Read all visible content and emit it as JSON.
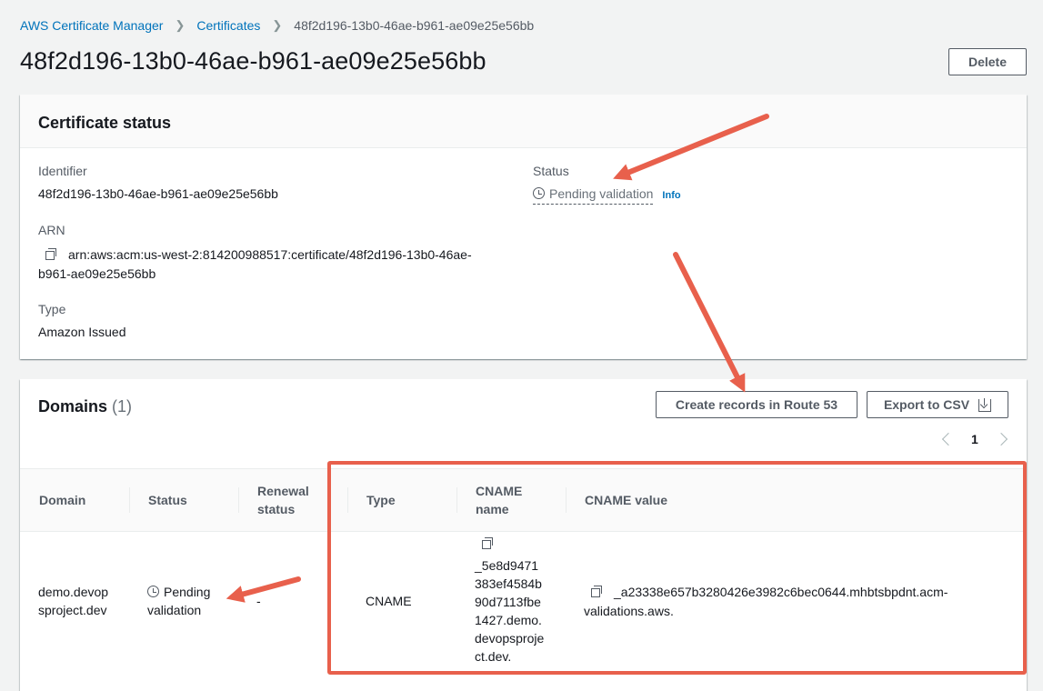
{
  "breadcrumb": {
    "root": "AWS Certificate Manager",
    "section": "Certificates",
    "current": "48f2d196-13b0-46ae-b961-ae09e25e56bb"
  },
  "page": {
    "title": "48f2d196-13b0-46ae-b961-ae09e25e56bb",
    "delete_label": "Delete"
  },
  "status_panel": {
    "title": "Certificate status",
    "identifier_label": "Identifier",
    "identifier_value": "48f2d196-13b0-46ae-b961-ae09e25e56bb",
    "arn_label": "ARN",
    "arn_line1": "arn:aws:acm:us-west-2:814200988517:certificate/48f2d196-13b0-46ae-",
    "arn_line2": "b961-ae09e25e56bb",
    "type_label": "Type",
    "type_value": "Amazon Issued",
    "status_label": "Status",
    "status_value": "Pending validation",
    "info_label": "Info"
  },
  "domains_panel": {
    "title": "Domains",
    "count": "(1)",
    "route53_label": "Create records in Route 53",
    "csv_label": "Export to CSV",
    "page_number": "1",
    "columns": {
      "domain": "Domain",
      "status": "Status",
      "renewal_1": "Renewal",
      "renewal_2": "status",
      "type": "Type",
      "cname_name_1": "CNAME",
      "cname_name_2": "name",
      "cname_value": "CNAME value"
    },
    "row": {
      "domain_1": "demo.devop",
      "domain_2": "sproject.dev",
      "status_1": "Pending",
      "status_2": "validation",
      "renewal": "-",
      "type": "CNAME",
      "cname_name_lines": [
        "_5e8d9471",
        "383ef4584b",
        "90d7113fbe",
        "1427.demo.",
        "devopsproje",
        "ct.dev."
      ],
      "cname_value_1": "_a23338e657b3280426e3982c6bec0644.mhbtsbpdnt.acm-",
      "cname_value_2": "validations.aws."
    }
  },
  "colors": {
    "link": "#0073bb",
    "annotation": "#e8604c",
    "page_bg": "#f2f3f3"
  }
}
